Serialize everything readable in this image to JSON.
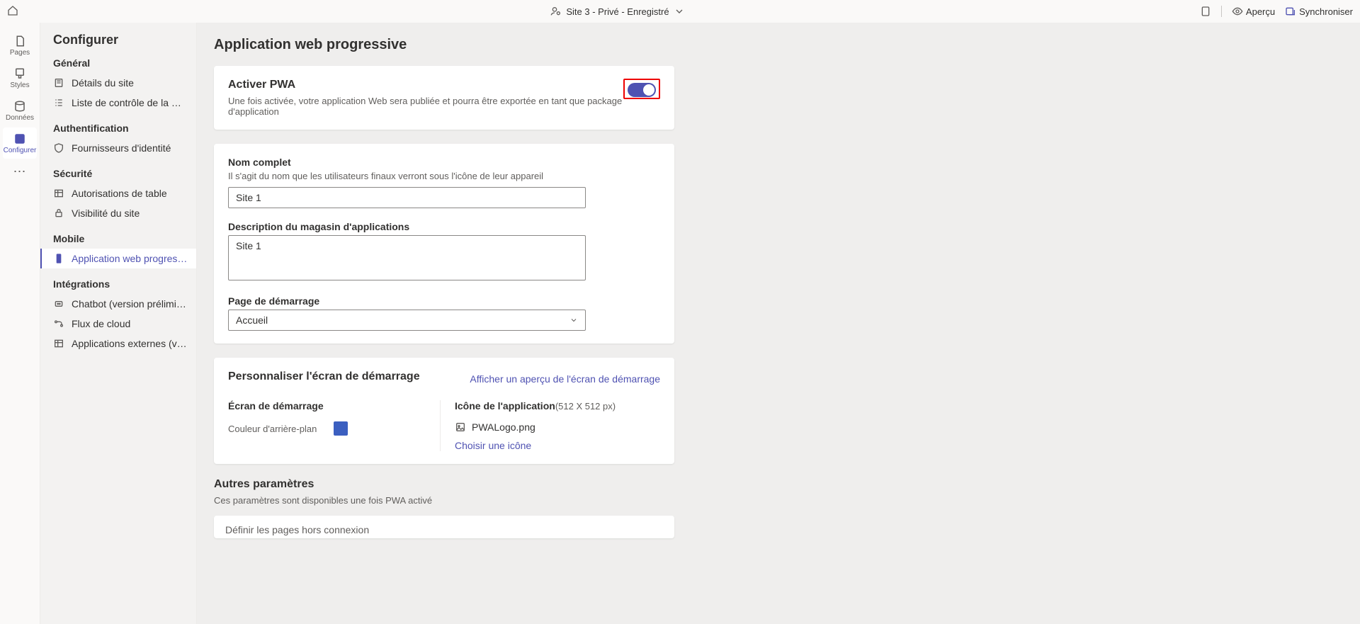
{
  "topbar": {
    "site_label": "Site 3 - Privé - Enregistré",
    "preview_label": "Aperçu",
    "sync_label": "Synchroniser"
  },
  "rail": {
    "pages": "Pages",
    "styles": "Styles",
    "data": "Données",
    "configure": "Configurer"
  },
  "sidebar": {
    "title": "Configurer",
    "groups": {
      "general": {
        "label": "Général",
        "items": [
          "Détails du site",
          "Liste de contrôle de la mise en ser..."
        ]
      },
      "auth": {
        "label": "Authentification",
        "items": [
          "Fournisseurs d'identité"
        ]
      },
      "security": {
        "label": "Sécurité",
        "items": [
          "Autorisations de table",
          "Visibilité du site"
        ]
      },
      "mobile": {
        "label": "Mobile",
        "items": [
          "Application web progressive"
        ]
      },
      "integrations": {
        "label": "Intégrations",
        "items": [
          "Chatbot (version préliminaire)",
          "Flux de cloud",
          "Applications externes (version prél..."
        ]
      }
    }
  },
  "page": {
    "title": "Application web progressive",
    "activate": {
      "title": "Activer PWA",
      "desc": "Une fois activée, votre application Web sera publiée et pourra être exportée en tant que package d'application"
    },
    "form": {
      "name_label": "Nom complet",
      "name_desc": "Il s'agit du nom que les utilisateurs finaux verront sous l'icône de leur appareil",
      "name_value": "Site 1",
      "store_desc_label": "Description du magasin d'applications",
      "store_desc_value": "Site 1",
      "start_page_label": "Page de démarrage",
      "start_page_value": "Accueil"
    },
    "splash": {
      "title": "Personnaliser l'écran de démarrage",
      "preview_link": "Afficher un aperçu de l'écran de démarrage",
      "screen_title": "Écran de démarrage",
      "bg_label": "Couleur d'arrière-plan",
      "bg_color": "#3b5fc0",
      "icon_title": "Icône de l'application",
      "icon_dim": "(512 X 512 px)",
      "icon_file": "PWALogo.png",
      "choose_icon": "Choisir une icône"
    },
    "other": {
      "title": "Autres paramètres",
      "desc": "Ces paramètres sont disponibles une fois PWA activé",
      "offline_label": "Définir les pages hors connexion"
    }
  }
}
